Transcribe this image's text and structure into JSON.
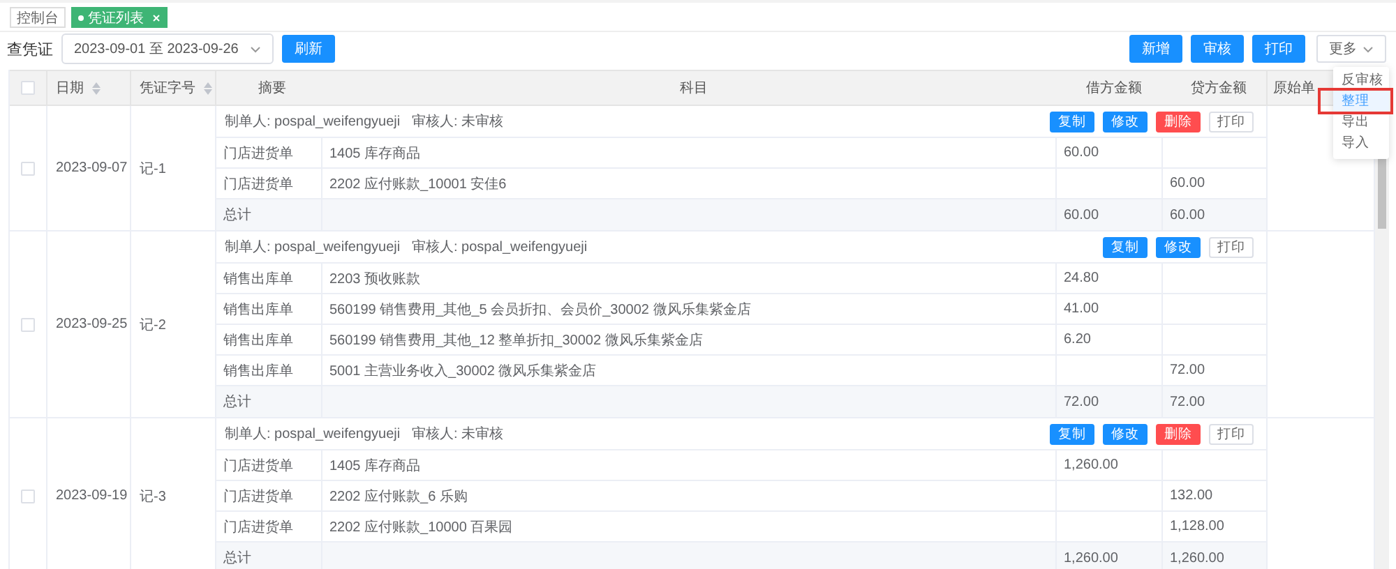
{
  "tabs": [
    {
      "label": "控制台",
      "selected": false,
      "closable": false
    },
    {
      "label": "凭证列表",
      "selected": true,
      "closable": true
    }
  ],
  "toolbar": {
    "label": "查凭证",
    "date_range": "2023-09-01 至 2023-09-26",
    "refresh": "刷新",
    "actions": [
      {
        "label": "新增",
        "kind": "primary"
      },
      {
        "label": "审核",
        "kind": "primary"
      },
      {
        "label": "打印",
        "kind": "primary"
      },
      {
        "label": "更多",
        "kind": "dropdown"
      }
    ]
  },
  "menu": {
    "items": [
      {
        "label": "反审核",
        "selected": false,
        "annotated": false
      },
      {
        "label": "整理",
        "selected": true,
        "annotated": true
      },
      {
        "label": "导出",
        "selected": false,
        "annotated": false
      },
      {
        "label": "导入",
        "selected": false,
        "annotated": false
      }
    ]
  },
  "table": {
    "select_all_checked": false,
    "columns": [
      {
        "label": "日期",
        "sortable": true
      },
      {
        "label": "凭证字号",
        "sortable": true
      },
      {
        "label": "摘要",
        "sortable": false
      },
      {
        "label": "科目",
        "sortable": false
      },
      {
        "label": "借方金额",
        "sortable": false
      },
      {
        "label": "贷方金额",
        "sortable": false
      },
      {
        "label": "原始单",
        "sortable": false
      }
    ],
    "vouchers": [
      {
        "checked": false,
        "date": "2023-09-07",
        "number": "记-1",
        "maker": "制单人: pospal_weifengyueji",
        "reviewer": "审核人: 未审核",
        "actions": [
          {
            "label": "复制",
            "kind": "primary"
          },
          {
            "label": "修改",
            "kind": "primary"
          },
          {
            "label": "删除",
            "kind": "danger"
          },
          {
            "label": "打印",
            "kind": "plain"
          }
        ],
        "lines": [
          {
            "summary": "门店进货单",
            "subject": "1405 库存商品",
            "debit": "60.00"
          },
          {
            "summary": "门店进货单",
            "subject": "2202 应付账款_10001 安佳6",
            "credit": "60.00"
          }
        ],
        "total": {
          "label": "总计",
          "debit": "60.00",
          "credit": "60.00"
        }
      },
      {
        "checked": false,
        "date": "2023-09-25",
        "number": "记-2",
        "maker": "制单人: pospal_weifengyueji",
        "reviewer": "审核人: pospal_weifengyueji",
        "actions": [
          {
            "label": "复制",
            "kind": "primary"
          },
          {
            "label": "修改",
            "kind": "primary"
          },
          {
            "label": "打印",
            "kind": "plain"
          }
        ],
        "lines": [
          {
            "summary": "销售出库单",
            "subject": "2203 预收账款",
            "debit": "24.80"
          },
          {
            "summary": "销售出库单",
            "subject": "560199 销售费用_其他_5 会员折扣、会员价_30002 微风乐集紫金店",
            "debit": "41.00"
          },
          {
            "summary": "销售出库单",
            "subject": "560199 销售费用_其他_12 整单折扣_30002 微风乐集紫金店",
            "debit": "6.20"
          },
          {
            "summary": "销售出库单",
            "subject": "5001 主营业务收入_30002 微风乐集紫金店",
            "credit": "72.00"
          }
        ],
        "total": {
          "label": "总计",
          "debit": "72.00",
          "credit": "72.00"
        }
      },
      {
        "checked": false,
        "date": "2023-09-19",
        "number": "记-3",
        "maker": "制单人: pospal_weifengyueji",
        "reviewer": "审核人: 未审核",
        "actions": [
          {
            "label": "复制",
            "kind": "primary"
          },
          {
            "label": "修改",
            "kind": "primary"
          },
          {
            "label": "删除",
            "kind": "danger"
          },
          {
            "label": "打印",
            "kind": "plain"
          }
        ],
        "lines": [
          {
            "summary": "门店进货单",
            "subject": "1405 库存商品",
            "debit": "1,260.00"
          },
          {
            "summary": "门店进货单",
            "subject": "2202 应付账款_6 乐购",
            "credit": "132.00"
          },
          {
            "summary": "门店进货单",
            "subject": "2202 应付账款_10000 百果园",
            "credit": "1,128.00"
          }
        ],
        "total": {
          "label": "总计",
          "debit": "1,260.00",
          "credit": "1,260.00"
        }
      }
    ]
  }
}
